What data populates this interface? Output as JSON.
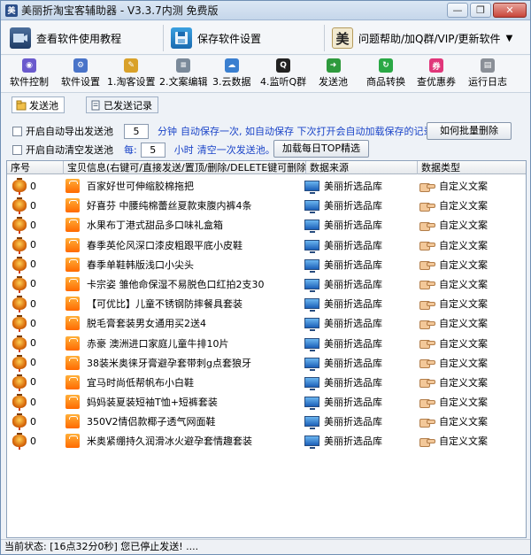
{
  "window": {
    "title": "美丽折淘宝客辅助器 - V3.3.7内测 免费版",
    "app_icon_glyph": "美",
    "controls": {
      "minimize": "—",
      "restore": "❐",
      "close": "✕"
    }
  },
  "bigbar": {
    "tutorial_label": "查看软件使用教程",
    "save_label": "保存软件设置",
    "help_label": "问题帮助/加Q群/VIP/更新软件",
    "help_icon_glyph": "美",
    "dropdown_glyph": "▼"
  },
  "tools": [
    {
      "label": "软件控制",
      "color": "#6a5acd",
      "glyph": "◉"
    },
    {
      "label": "软件设置",
      "color": "#4a74c9",
      "glyph": "⚙"
    },
    {
      "label": "1.淘客设置",
      "color": "#d9a12a",
      "glyph": "✎"
    },
    {
      "label": "2.文案编辑",
      "color": "#7b8a9a",
      "glyph": "≡"
    },
    {
      "label": "3.云数据",
      "color": "#3a7fd0",
      "glyph": "☁"
    },
    {
      "label": "4.监听Q群",
      "color": "#222222",
      "glyph": "Q"
    },
    {
      "label": "发送池",
      "color": "#2e9a3d",
      "glyph": "➜"
    },
    {
      "label": "商品转换",
      "color": "#2aa845",
      "glyph": "↻"
    },
    {
      "label": "查优惠券",
      "color": "#e0367a",
      "glyph": "券"
    },
    {
      "label": "运行日志",
      "color": "#8a8f97",
      "glyph": "▤"
    }
  ],
  "tabs": [
    {
      "label": "发送池",
      "active": true
    },
    {
      "label": "已发送记录",
      "active": false
    }
  ],
  "options": {
    "auto_export_label": "开启自动导出发送池",
    "auto_export_value": "5",
    "auto_export_unit": "分钟",
    "auto_export_desc": "自动保存一次, 如自动保存 下次打开会自动加载保存的记录。",
    "batch_delete_label": "如何批量删除",
    "auto_clear_label": "开启自动清空发送池",
    "auto_clear_prefix": "每:",
    "auto_clear_value": "5",
    "auto_clear_unit": "小时",
    "auto_clear_desc": "清空一次发送池。",
    "load_top_label": "加载每日TOP精选"
  },
  "table": {
    "columns": [
      "序号",
      "宝贝信息(右键可/直接发送/置顶/删除/DELETE键可删除)",
      "数据来源",
      "数据类型"
    ],
    "rows": [
      {
        "index": "0",
        "title": "百家好世可伸缩胶棉拖把",
        "source": "美丽折选品库",
        "type": "自定义文案"
      },
      {
        "index": "0",
        "title": "好喜芬 中腰纯棉蕾丝夏款束腹内裤4条",
        "source": "美丽折选品库",
        "type": "自定义文案"
      },
      {
        "index": "0",
        "title": "水果布丁港式甜品多口味礼盒箱",
        "source": "美丽折选品库",
        "type": "自定义文案"
      },
      {
        "index": "0",
        "title": "春季英伦风深口漆皮粗跟平底小皮鞋",
        "source": "美丽折选品库",
        "type": "自定义文案"
      },
      {
        "index": "0",
        "title": "春季单鞋韩版浅口小尖头",
        "source": "美丽折选品库",
        "type": "自定义文案"
      },
      {
        "index": "0",
        "title": "卡宗姿  雏他命保湿不易脱色口红拍2支30",
        "source": "美丽折选品库",
        "type": "自定义文案"
      },
      {
        "index": "0",
        "title": "【可优比】儿童不锈钢防摔餐具套装",
        "source": "美丽折选品库",
        "type": "自定义文案"
      },
      {
        "index": "0",
        "title": "脱毛膏套装男女通用买2送4",
        "source": "美丽折选品库",
        "type": "自定义文案"
      },
      {
        "index": "0",
        "title": "赤豪  澳洲进口家庭儿童牛排10片",
        "source": "美丽折选品库",
        "type": "自定义文案"
      },
      {
        "index": "0",
        "title": "38装米奥徕牙膏避孕套带刺g点套狼牙",
        "source": "美丽折选品库",
        "type": "自定义文案"
      },
      {
        "index": "0",
        "title": "宜马时尚低帮帆布小白鞋",
        "source": "美丽折选品库",
        "type": "自定义文案"
      },
      {
        "index": "0",
        "title": "妈妈装夏装短袖T恤+短裤套装",
        "source": "美丽折选品库",
        "type": "自定义文案"
      },
      {
        "index": "0",
        "title": "350V2情侣款椰子透气网面鞋",
        "source": "美丽折选品库",
        "type": "自定义文案"
      },
      {
        "index": "0",
        "title": "米奥紧绷持久润滑冰火避孕套情趣套装",
        "source": "美丽折选品库",
        "type": "自定义文案"
      }
    ]
  },
  "status": {
    "text": "当前状态: [16点32分0秒] 您已停止发送! ...."
  },
  "colors": {
    "accent_blue": "#1a44c8",
    "border": "#8ea2bb"
  }
}
